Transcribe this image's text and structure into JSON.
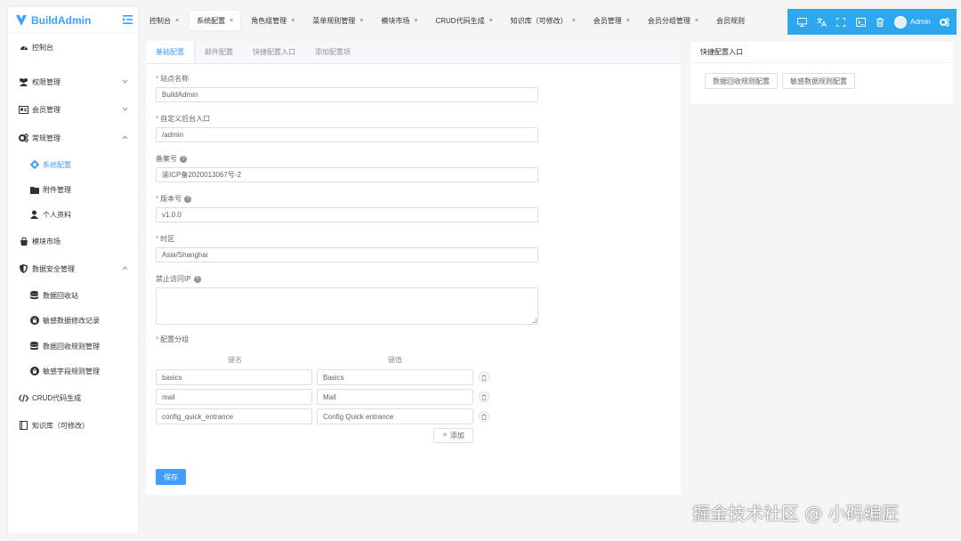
{
  "brand": {
    "name": "BuildAdmin"
  },
  "sidebar": {
    "items": [
      {
        "label": "控制台",
        "icon": "dashboard-icon"
      },
      {
        "label": "权限管理",
        "icon": "users-icon"
      },
      {
        "label": "会员管理",
        "icon": "id-card-icon"
      },
      {
        "label": "常规管理",
        "icon": "cogs-icon"
      },
      {
        "label": "系统配置",
        "icon": "gear-icon"
      },
      {
        "label": "附件管理",
        "icon": "folder-icon"
      },
      {
        "label": "个人资料",
        "icon": "user-icon"
      },
      {
        "label": "模块市场",
        "icon": "shopping-bag-icon"
      },
      {
        "label": "数据安全管理",
        "icon": "shield-icon"
      },
      {
        "label": "数据回收站",
        "icon": "database-icon"
      },
      {
        "label": "敏感数据修改记录",
        "icon": "lock-icon"
      },
      {
        "label": "数据回收规则管理",
        "icon": "database-icon"
      },
      {
        "label": "敏感字段规则管理",
        "icon": "lock-icon"
      },
      {
        "label": "CRUD代码生成",
        "icon": "code-icon"
      },
      {
        "label": "知识库（可修改）",
        "icon": "book-icon"
      }
    ]
  },
  "tabs": [
    {
      "label": "控制台",
      "close": "×"
    },
    {
      "label": "系统配置",
      "close": "×"
    },
    {
      "label": "角色组管理",
      "close": "×"
    },
    {
      "label": "菜单规则管理",
      "close": "×"
    },
    {
      "label": "模块市场",
      "close": "×"
    },
    {
      "label": "CRUD代码生成",
      "close": "×"
    },
    {
      "label": "知识库（可修改）",
      "close": "×"
    },
    {
      "label": "会员管理",
      "close": "×"
    },
    {
      "label": "会员分组管理",
      "close": "×"
    },
    {
      "label": "会员规则",
      "close": ""
    }
  ],
  "topbar": {
    "user": "Admin",
    "accent": "#2ba8f0"
  },
  "config_tabs": [
    "基础配置",
    "邮件配置",
    "快捷配置入口",
    "添加配置项"
  ],
  "form": {
    "site_name": {
      "label": "站点名称",
      "value": "BuildAdmin"
    },
    "backend_entrance": {
      "label": "自定义后台入口",
      "value": "/admin"
    },
    "record_number": {
      "label": "备案号",
      "value": "渝ICP备2020013067号-2"
    },
    "version": {
      "label": "版本号",
      "value": "v1.0.0"
    },
    "timezone": {
      "label": "时区",
      "value": "Asia/Shanghai"
    },
    "no_access_ip": {
      "label": "禁止访问IP",
      "value": ""
    },
    "config_group": {
      "label": "配置分组",
      "key_header": "键名",
      "value_header": "键值",
      "rows": [
        {
          "key": "basics",
          "value": "Basics"
        },
        {
          "key": "mail",
          "value": "Mail"
        },
        {
          "key": "config_quick_entrance",
          "value": "Config Quick entrance"
        }
      ],
      "add_label": "添加"
    },
    "save_label": "保存"
  },
  "quick": {
    "title": "快捷配置入口",
    "buttons": [
      "数据回收规则配置",
      "敏感数据规则配置"
    ]
  },
  "watermark": "掘金技术社区 @ 小码编匠"
}
